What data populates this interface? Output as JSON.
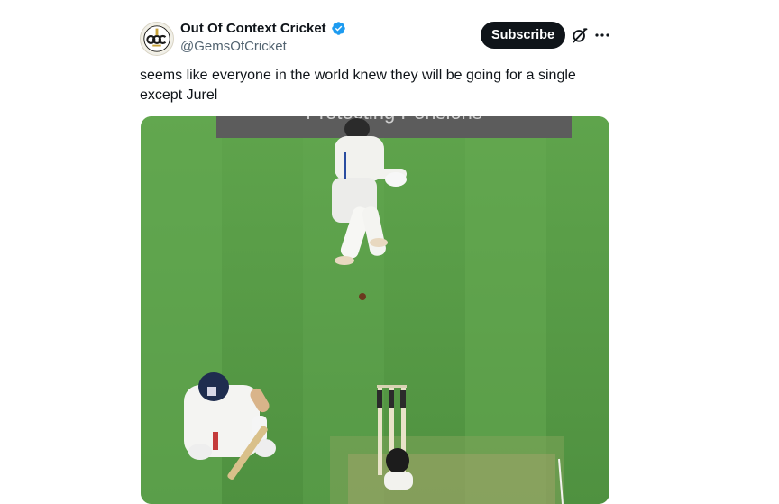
{
  "account": {
    "display_name": "Out Of Context Cricket",
    "handle": "@GemsOfCricket",
    "verified": true,
    "avatar_logo_text": "OOC"
  },
  "actions": {
    "subscribe_label": "Subscribe",
    "grok_icon": "grok-icon",
    "more_icon": "more-icon"
  },
  "post": {
    "text_lines": [
      "seems like everyone in the world knew they will be going for a single",
      "except Jurel"
    ]
  },
  "media": {
    "description_icon": "cricket-video-frame",
    "banner_text": "Protecting Pensions"
  },
  "colors": {
    "verified": "#1d9bf0",
    "button_bg": "#0f1419",
    "pitch_green": "#5b9e4a"
  }
}
